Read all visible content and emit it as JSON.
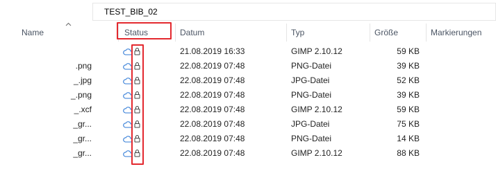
{
  "breadcrumb": {
    "folder": "TEST_BIB_02"
  },
  "columns": {
    "name": "Name",
    "status": "Status",
    "date": "Datum",
    "type": "Typ",
    "size": "Größe",
    "tags": "Markierungen"
  },
  "icons": {
    "status_cloud": "cloud-icon",
    "status_lock": "lock-icon",
    "sort": "chevron-up-icon"
  },
  "colors": {
    "highlight": "#e3282e",
    "cloud": "#2f7ad6"
  },
  "rows": [
    {
      "name": "",
      "date": "21.08.2019 16:33",
      "type": "GIMP 2.10.12",
      "size": "59 KB"
    },
    {
      "name": ".png",
      "date": "22.08.2019 07:48",
      "type": "PNG-Datei",
      "size": "39 KB"
    },
    {
      "name": "_.jpg",
      "date": "22.08.2019 07:48",
      "type": "JPG-Datei",
      "size": "52 KB"
    },
    {
      "name": "_.png",
      "date": "22.08.2019 07:48",
      "type": "PNG-Datei",
      "size": "39 KB"
    },
    {
      "name": "_.xcf",
      "date": "22.08.2019 07:48",
      "type": "GIMP 2.10.12",
      "size": "59 KB"
    },
    {
      "name": "_gr...",
      "date": "22.08.2019 07:48",
      "type": "JPG-Datei",
      "size": "75 KB"
    },
    {
      "name": "_gr...",
      "date": "22.08.2019 07:48",
      "type": "PNG-Datei",
      "size": "14 KB"
    },
    {
      "name": "_gr...",
      "date": "22.08.2019 07:48",
      "type": "GIMP 2.10.12",
      "size": "88 KB"
    }
  ]
}
